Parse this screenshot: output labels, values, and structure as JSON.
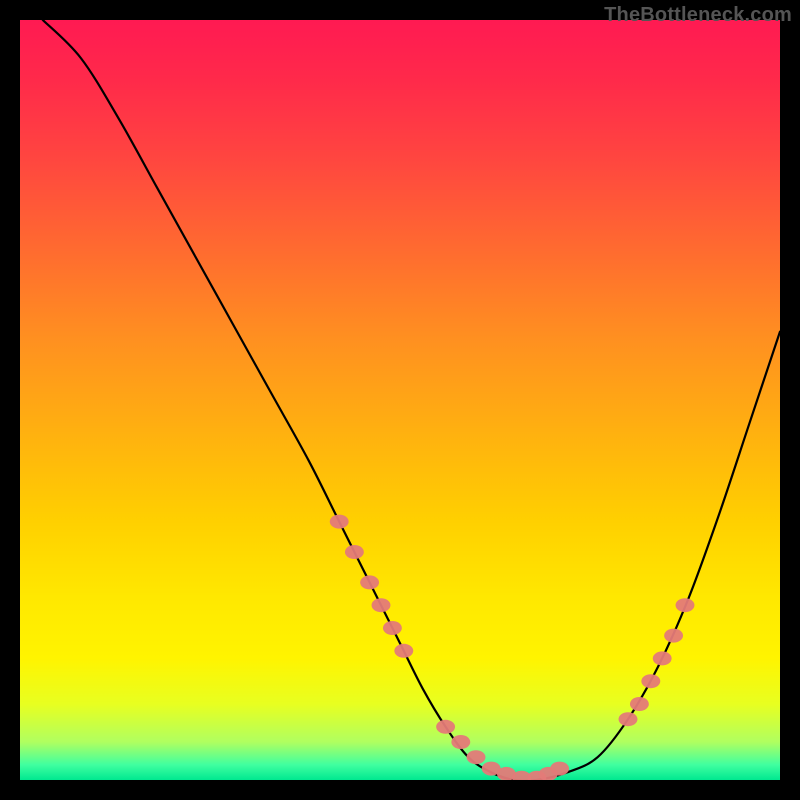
{
  "watermark": "TheBottleneck.com",
  "chart_data": {
    "type": "line",
    "title": "",
    "xlabel": "",
    "ylabel": "",
    "xlim": [
      0,
      100
    ],
    "ylim": [
      0,
      100
    ],
    "grid": false,
    "legend": false,
    "annotations": [],
    "series": [
      {
        "name": "bottleneck-curve",
        "x": [
          3,
          8,
          13,
          18,
          23,
          28,
          33,
          38,
          42,
          46,
          50,
          53,
          56,
          59,
          62,
          65,
          68,
          72,
          76,
          80,
          84,
          88,
          92,
          96,
          100
        ],
        "values": [
          100,
          95,
          87,
          78,
          69,
          60,
          51,
          42,
          34,
          26,
          18,
          12,
          7,
          3,
          1,
          0,
          0,
          1,
          3,
          8,
          15,
          24,
          35,
          47,
          59
        ]
      }
    ],
    "markers": {
      "name": "threshold-dots",
      "color": "#e47a78",
      "x": [
        42,
        44,
        46,
        47.5,
        49,
        50.5,
        56,
        58,
        60,
        62,
        64,
        66,
        68,
        69.5,
        71,
        80,
        81.5,
        83,
        84.5,
        86,
        87.5
      ],
      "values": [
        34,
        30,
        26,
        23,
        20,
        17,
        7,
        5,
        3,
        1.5,
        0.8,
        0.3,
        0.3,
        0.8,
        1.5,
        8,
        10,
        13,
        16,
        19,
        23
      ]
    },
    "gradient_background": {
      "description": "vertical gradient red→yellow→green representing bottleneck severity",
      "stops": [
        {
          "pos": 0,
          "color": "#ff1a52"
        },
        {
          "pos": 50,
          "color": "#ffc800"
        },
        {
          "pos": 90,
          "color": "#f0ff30"
        },
        {
          "pos": 100,
          "color": "#00e890"
        }
      ]
    }
  }
}
